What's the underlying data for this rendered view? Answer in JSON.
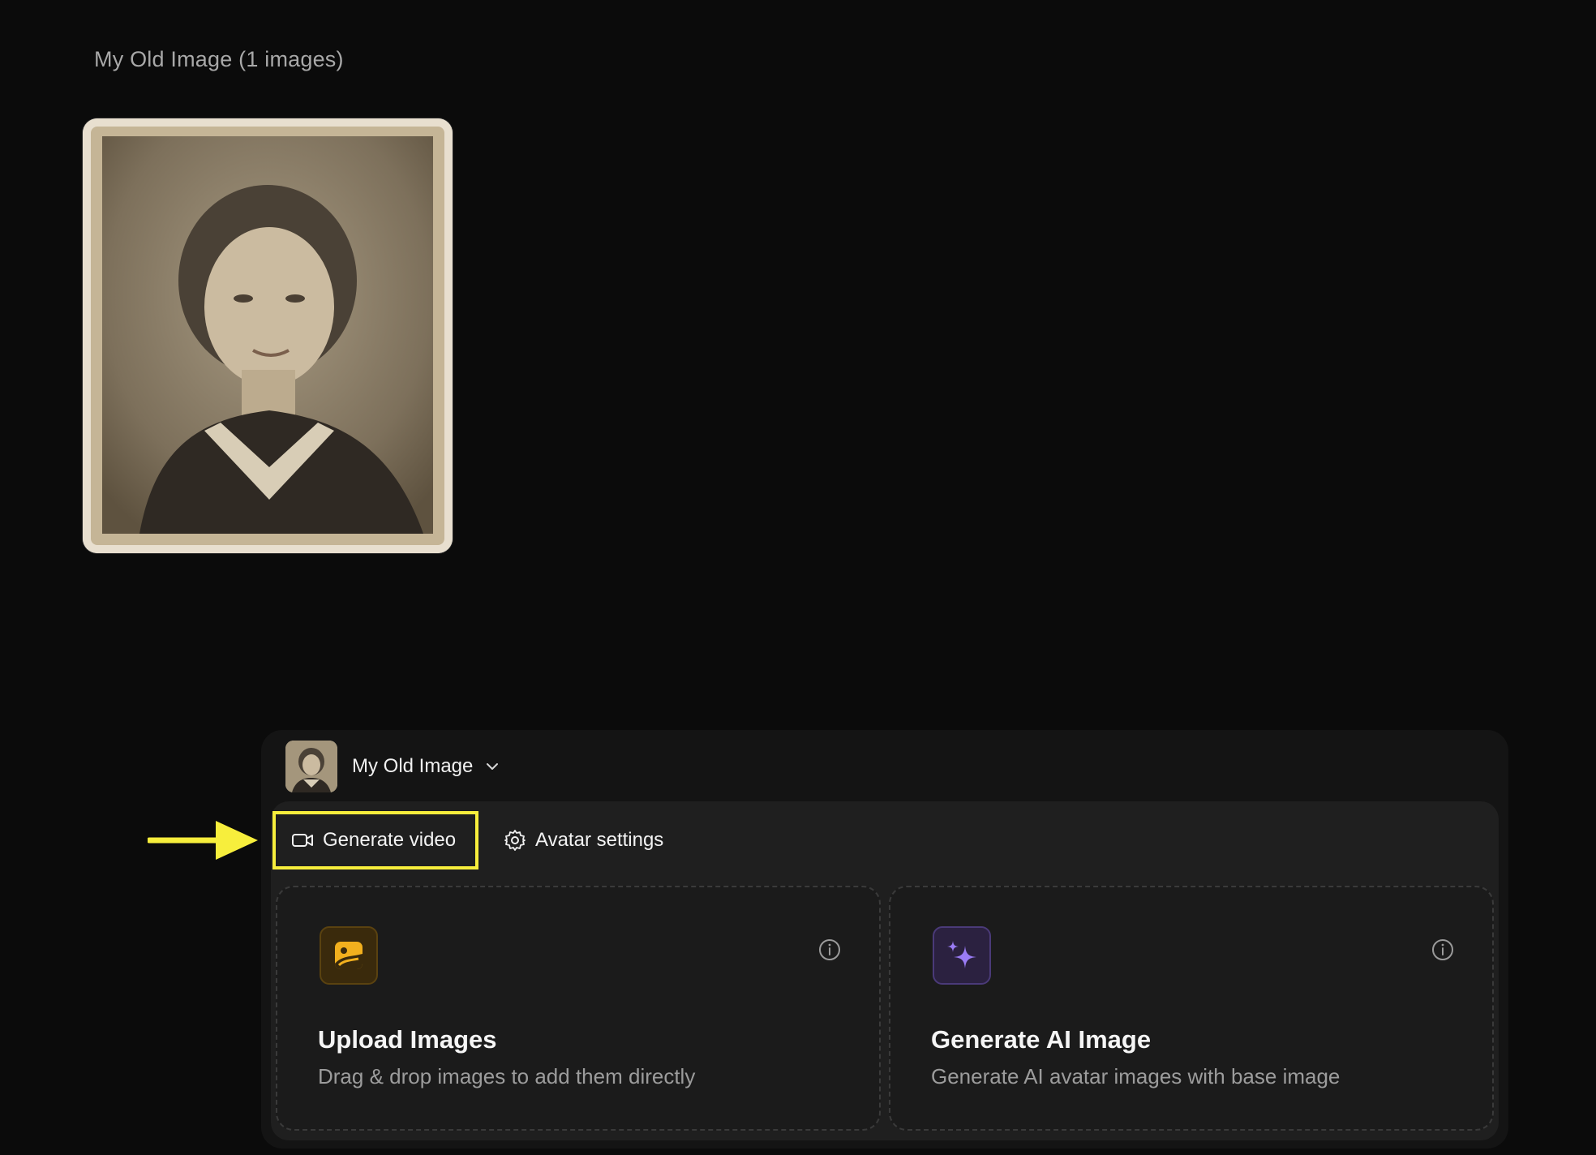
{
  "gallery": {
    "title": "My Old Image (1 images)"
  },
  "avatar_selector": {
    "name": "My Old Image",
    "chevron_icon": "chevron-down-icon"
  },
  "tabs": {
    "generate_video": {
      "label": "Generate video",
      "icon": "video-camera-icon"
    },
    "avatar_settings": {
      "label": "Avatar settings",
      "icon": "gear-icon"
    }
  },
  "cards": {
    "upload": {
      "title": "Upload Images",
      "description": "Drag & drop images to add them directly",
      "icon": "image-upload-icon",
      "accent": "#f2b01e"
    },
    "generate_ai": {
      "title": "Generate AI Image",
      "description": "Generate AI avatar images with base image",
      "icon": "sparkles-icon",
      "accent": "#9a7cf5"
    }
  },
  "annotation": {
    "highlight_color": "#f7ee3c"
  }
}
